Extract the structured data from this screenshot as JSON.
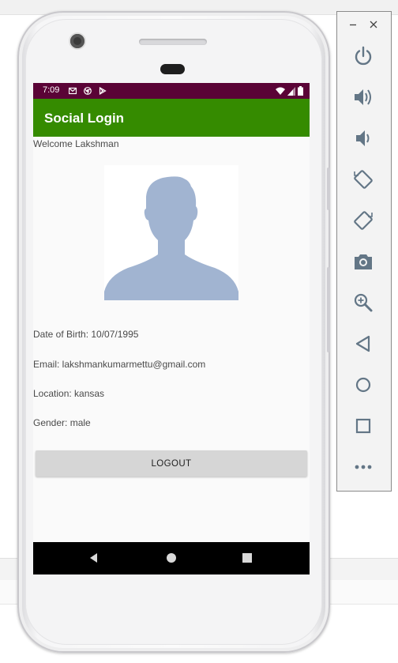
{
  "status_bar": {
    "time": "7:09",
    "background": "#5a0336"
  },
  "app_bar": {
    "title": "Social Login",
    "color": "#358b00"
  },
  "profile": {
    "welcome": "Welcome Lakshman",
    "dob": "Date of Birth: 10/07/1995",
    "email": "Email: lakshmankumarmettu@gmail.com",
    "location": "Location: kansas",
    "gender": "Gender: male"
  },
  "actions": {
    "logout_label": "LOGOUT"
  },
  "icons": {
    "avatar": "default-profile-silhouette",
    "status_left": [
      "gmail-icon",
      "chrome-icon",
      "play-store-icon"
    ],
    "status_right": [
      "wifi-icon",
      "cellular-signal-icon",
      "battery-icon"
    ],
    "nav": [
      "back-icon",
      "home-icon",
      "recents-icon"
    ],
    "emulator": [
      "minimize-icon",
      "close-icon",
      "power-icon",
      "volume-up-icon",
      "volume-down-icon",
      "rotate-left-icon",
      "rotate-right-icon",
      "camera-icon",
      "zoom-icon",
      "back-icon",
      "home-icon",
      "overview-icon",
      "more-icon"
    ]
  }
}
